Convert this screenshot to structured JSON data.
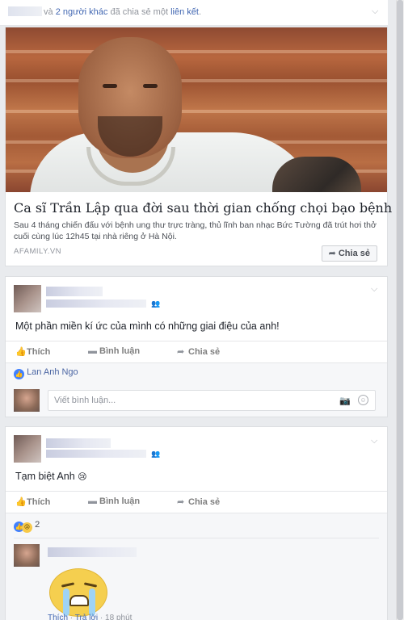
{
  "share_header": {
    "prefix": "và",
    "others_link": "2 người khác",
    "middle": "đã chia sẻ một",
    "link_word": "liên kết",
    "suffix": "."
  },
  "link_card": {
    "title": "Ca sĩ Trần Lập qua đời sau thời gian chống chọi bạo bệnh",
    "description": "Sau 4 tháng chiến đấu với bệnh ung thư trực tràng, thủ lĩnh ban nhạc Bức Tường đã trút hơi thở cuối cùng lúc 12h45 tại nhà riêng ở Hà Nội.",
    "domain": "AFAMILY.VN",
    "share_label": "Chia sẻ"
  },
  "post1": {
    "text": "Một phần miền kí ức của mình có những giai điệu của anh!",
    "actions": {
      "like": "Thích",
      "comment": "Bình luận",
      "share": "Chia sẻ"
    },
    "liker": "Lan Anh Ngo",
    "comment_placeholder": "Viết bình luận..."
  },
  "post2": {
    "text": "Tạm biệt Anh",
    "actions": {
      "like": "Thích",
      "comment": "Bình luận",
      "share": "Chia sẻ"
    },
    "reaction_count": "2",
    "comment_meta": {
      "like": "Thích",
      "sep1": " · ",
      "reply": "Trả lời",
      "sep2": " · ",
      "time": "18 phút"
    }
  }
}
